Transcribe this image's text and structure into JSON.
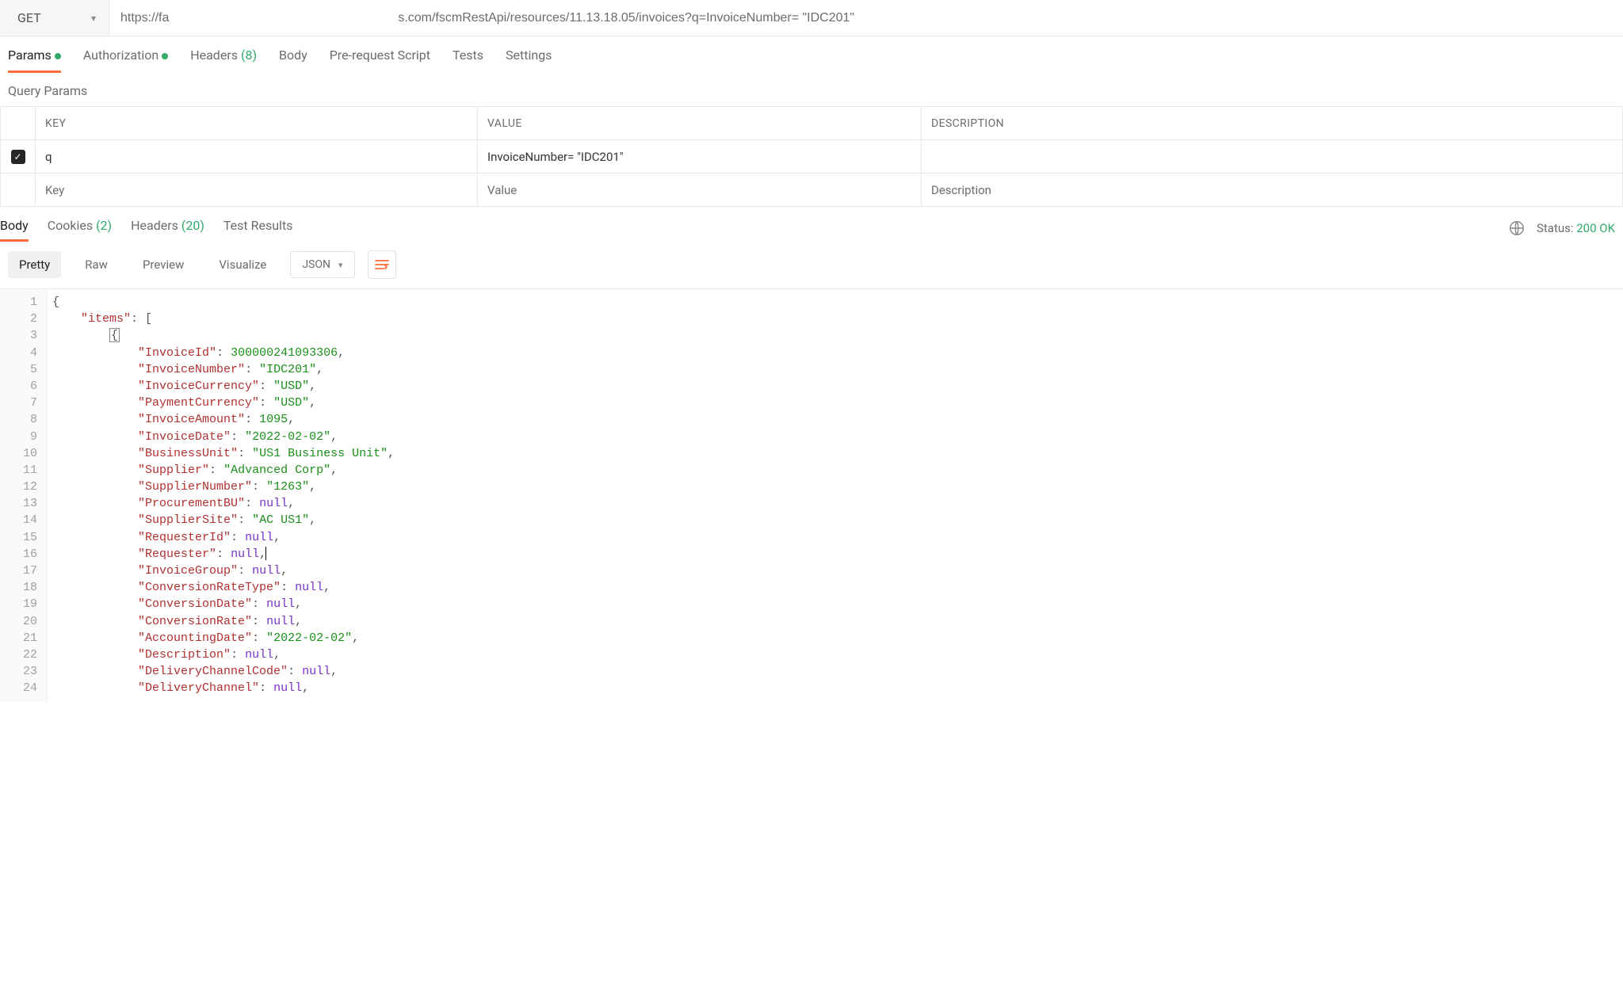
{
  "request": {
    "method": "GET",
    "url": "https://fa                                                                 s.com/fscmRestApi/resources/11.13.18.05/invoices?q=InvoiceNumber= \"IDC201\"",
    "tabs": {
      "params": "Params",
      "authorization": "Authorization",
      "headers": "Headers",
      "headers_count": "(8)",
      "body": "Body",
      "prescript": "Pre-request Script",
      "tests": "Tests",
      "settings": "Settings"
    }
  },
  "query_params": {
    "section_title": "Query Params",
    "headers": {
      "key": "KEY",
      "value": "VALUE",
      "description": "DESCRIPTION"
    },
    "rows": [
      {
        "checked": true,
        "key": "q",
        "value": "InvoiceNumber= \"IDC201\"",
        "description": ""
      }
    ],
    "placeholders": {
      "key": "Key",
      "value": "Value",
      "description": "Description"
    }
  },
  "response": {
    "tabs": {
      "body": "Body",
      "cookies": "Cookies",
      "cookies_count": "(2)",
      "headers": "Headers",
      "headers_count": "(20)",
      "testresults": "Test Results"
    },
    "status_label": "Status:",
    "status_value": "200 OK",
    "viewmodes": {
      "pretty": "Pretty",
      "raw": "Raw",
      "preview": "Preview",
      "visualize": "Visualize"
    },
    "format": "JSON"
  },
  "json_lines": [
    {
      "n": 1,
      "indent": 0,
      "tokens": [
        {
          "t": "punc",
          "v": "{"
        }
      ]
    },
    {
      "n": 2,
      "indent": 1,
      "tokens": [
        {
          "t": "key",
          "v": "\"items\""
        },
        {
          "t": "punc",
          "v": ": ["
        }
      ]
    },
    {
      "n": 3,
      "indent": 2,
      "tokens": [
        {
          "t": "bracket",
          "v": "{"
        }
      ]
    },
    {
      "n": 4,
      "indent": 3,
      "tokens": [
        {
          "t": "key",
          "v": "\"InvoiceId\""
        },
        {
          "t": "punc",
          "v": ": "
        },
        {
          "t": "num",
          "v": "300000241093306"
        },
        {
          "t": "punc",
          "v": ","
        }
      ]
    },
    {
      "n": 5,
      "indent": 3,
      "tokens": [
        {
          "t": "key",
          "v": "\"InvoiceNumber\""
        },
        {
          "t": "punc",
          "v": ": "
        },
        {
          "t": "str",
          "v": "\"IDC201\""
        },
        {
          "t": "punc",
          "v": ","
        }
      ]
    },
    {
      "n": 6,
      "indent": 3,
      "tokens": [
        {
          "t": "key",
          "v": "\"InvoiceCurrency\""
        },
        {
          "t": "punc",
          "v": ": "
        },
        {
          "t": "str",
          "v": "\"USD\""
        },
        {
          "t": "punc",
          "v": ","
        }
      ]
    },
    {
      "n": 7,
      "indent": 3,
      "tokens": [
        {
          "t": "key",
          "v": "\"PaymentCurrency\""
        },
        {
          "t": "punc",
          "v": ": "
        },
        {
          "t": "str",
          "v": "\"USD\""
        },
        {
          "t": "punc",
          "v": ","
        }
      ]
    },
    {
      "n": 8,
      "indent": 3,
      "tokens": [
        {
          "t": "key",
          "v": "\"InvoiceAmount\""
        },
        {
          "t": "punc",
          "v": ": "
        },
        {
          "t": "num",
          "v": "1095"
        },
        {
          "t": "punc",
          "v": ","
        }
      ]
    },
    {
      "n": 9,
      "indent": 3,
      "tokens": [
        {
          "t": "key",
          "v": "\"InvoiceDate\""
        },
        {
          "t": "punc",
          "v": ": "
        },
        {
          "t": "str",
          "v": "\"2022-02-02\""
        },
        {
          "t": "punc",
          "v": ","
        }
      ]
    },
    {
      "n": 10,
      "indent": 3,
      "tokens": [
        {
          "t": "key",
          "v": "\"BusinessUnit\""
        },
        {
          "t": "punc",
          "v": ": "
        },
        {
          "t": "str",
          "v": "\"US1 Business Unit\""
        },
        {
          "t": "punc",
          "v": ","
        }
      ]
    },
    {
      "n": 11,
      "indent": 3,
      "tokens": [
        {
          "t": "key",
          "v": "\"Supplier\""
        },
        {
          "t": "punc",
          "v": ": "
        },
        {
          "t": "str",
          "v": "\"Advanced Corp\""
        },
        {
          "t": "punc",
          "v": ","
        }
      ]
    },
    {
      "n": 12,
      "indent": 3,
      "tokens": [
        {
          "t": "key",
          "v": "\"SupplierNumber\""
        },
        {
          "t": "punc",
          "v": ": "
        },
        {
          "t": "str",
          "v": "\"1263\""
        },
        {
          "t": "punc",
          "v": ","
        }
      ]
    },
    {
      "n": 13,
      "indent": 3,
      "tokens": [
        {
          "t": "key",
          "v": "\"ProcurementBU\""
        },
        {
          "t": "punc",
          "v": ": "
        },
        {
          "t": "null",
          "v": "null"
        },
        {
          "t": "punc",
          "v": ","
        }
      ]
    },
    {
      "n": 14,
      "indent": 3,
      "tokens": [
        {
          "t": "key",
          "v": "\"SupplierSite\""
        },
        {
          "t": "punc",
          "v": ": "
        },
        {
          "t": "str",
          "v": "\"AC US1\""
        },
        {
          "t": "punc",
          "v": ","
        }
      ]
    },
    {
      "n": 15,
      "indent": 3,
      "tokens": [
        {
          "t": "key",
          "v": "\"RequesterId\""
        },
        {
          "t": "punc",
          "v": ": "
        },
        {
          "t": "null",
          "v": "null"
        },
        {
          "t": "punc",
          "v": ","
        }
      ]
    },
    {
      "n": 16,
      "indent": 3,
      "tokens": [
        {
          "t": "key",
          "v": "\"Requester\""
        },
        {
          "t": "punc",
          "v": ": "
        },
        {
          "t": "null",
          "v": "null"
        },
        {
          "t": "punc",
          "v": ","
        },
        {
          "t": "cursor",
          "v": ""
        }
      ]
    },
    {
      "n": 17,
      "indent": 3,
      "tokens": [
        {
          "t": "key",
          "v": "\"InvoiceGroup\""
        },
        {
          "t": "punc",
          "v": ": "
        },
        {
          "t": "null",
          "v": "null"
        },
        {
          "t": "punc",
          "v": ","
        }
      ]
    },
    {
      "n": 18,
      "indent": 3,
      "tokens": [
        {
          "t": "key",
          "v": "\"ConversionRateType\""
        },
        {
          "t": "punc",
          "v": ": "
        },
        {
          "t": "null",
          "v": "null"
        },
        {
          "t": "punc",
          "v": ","
        }
      ]
    },
    {
      "n": 19,
      "indent": 3,
      "tokens": [
        {
          "t": "key",
          "v": "\"ConversionDate\""
        },
        {
          "t": "punc",
          "v": ": "
        },
        {
          "t": "null",
          "v": "null"
        },
        {
          "t": "punc",
          "v": ","
        }
      ]
    },
    {
      "n": 20,
      "indent": 3,
      "tokens": [
        {
          "t": "key",
          "v": "\"ConversionRate\""
        },
        {
          "t": "punc",
          "v": ": "
        },
        {
          "t": "null",
          "v": "null"
        },
        {
          "t": "punc",
          "v": ","
        }
      ]
    },
    {
      "n": 21,
      "indent": 3,
      "tokens": [
        {
          "t": "key",
          "v": "\"AccountingDate\""
        },
        {
          "t": "punc",
          "v": ": "
        },
        {
          "t": "str",
          "v": "\"2022-02-02\""
        },
        {
          "t": "punc",
          "v": ","
        }
      ]
    },
    {
      "n": 22,
      "indent": 3,
      "tokens": [
        {
          "t": "key",
          "v": "\"Description\""
        },
        {
          "t": "punc",
          "v": ": "
        },
        {
          "t": "null",
          "v": "null"
        },
        {
          "t": "punc",
          "v": ","
        }
      ]
    },
    {
      "n": 23,
      "indent": 3,
      "tokens": [
        {
          "t": "key",
          "v": "\"DeliveryChannelCode\""
        },
        {
          "t": "punc",
          "v": ": "
        },
        {
          "t": "null",
          "v": "null"
        },
        {
          "t": "punc",
          "v": ","
        }
      ]
    },
    {
      "n": 24,
      "indent": 3,
      "tokens": [
        {
          "t": "key",
          "v": "\"DeliveryChannel\""
        },
        {
          "t": "punc",
          "v": ": "
        },
        {
          "t": "null",
          "v": "null"
        },
        {
          "t": "punc",
          "v": ","
        }
      ]
    }
  ]
}
